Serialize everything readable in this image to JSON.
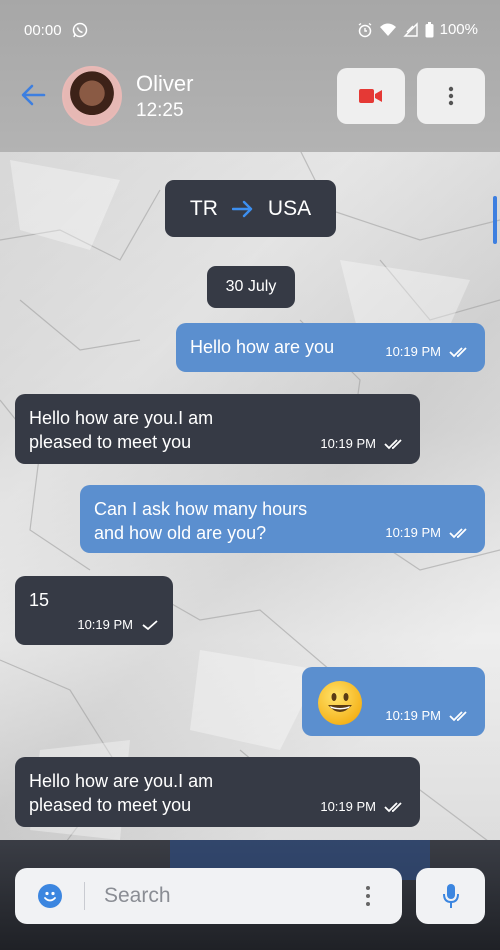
{
  "status_bar": {
    "time": "00:00",
    "battery": "100%"
  },
  "header": {
    "contact_name": "Oliver",
    "contact_time": "12:25"
  },
  "language": {
    "from": "TR",
    "to": "USA"
  },
  "date_label": "30 July",
  "messages": [
    {
      "direction": "out",
      "lines": [
        "Hello how are you"
      ],
      "time": "10:19 PM"
    },
    {
      "direction": "in",
      "lines": [
        "Hello how are you.I am",
        "pleased to meet you"
      ],
      "time": "10:19 PM"
    },
    {
      "direction": "out",
      "lines": [
        "Can I ask how many hours",
        "and how old are you?"
      ],
      "time": "10:19 PM"
    },
    {
      "direction": "in",
      "lines": [
        "15"
      ],
      "time": "10:19 PM"
    },
    {
      "direction": "out",
      "emoji": "grinning-face",
      "time": "10:19 PM"
    },
    {
      "direction": "in",
      "lines": [
        "Hello how are you.I am",
        "pleased to meet you"
      ],
      "time": "10:19 PM"
    }
  ],
  "input": {
    "placeholder": "Search"
  },
  "colors": {
    "accent": "#3d7fe0",
    "outgoing_bubble": "#5b8fcf",
    "incoming_bubble": "#363a45",
    "video_icon": "#e53935"
  }
}
